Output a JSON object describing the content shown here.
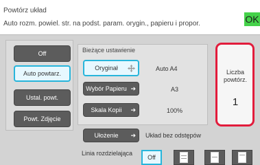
{
  "header": {
    "title": "Powtórz układ",
    "subtitle": "Auto rozm. powiel. str. na podst. param. orygin., papieru i propor.",
    "ok_label": "OK"
  },
  "modes": {
    "items": [
      {
        "label": "Off",
        "selected": false
      },
      {
        "label": "Auto powtarz.",
        "selected": true
      },
      {
        "label": "Ustal. powt.",
        "selected": false
      },
      {
        "label": "Powt. Zdjęcie",
        "selected": false
      }
    ]
  },
  "current_settings": {
    "heading": "Bieżące ustawienie",
    "original": {
      "label": "Oryginał",
      "value": "Auto   A4"
    },
    "paper": {
      "label": "Wybór Papieru",
      "value": "A3"
    },
    "scale": {
      "label": "Skala Kopii",
      "value": "100%"
    }
  },
  "repeat": {
    "label": "Liczba powtórz.",
    "value": "1"
  },
  "layout": {
    "label": "Ułożenie",
    "value": "Układ bez odstępów"
  },
  "divider": {
    "label": "Linia rozdzielająca",
    "off_label": "Off"
  },
  "colors": {
    "accent": "#27b5db",
    "ok_green": "#45d24a",
    "highlight_red": "#e21c3c",
    "button_dark": "#5c5c5c"
  }
}
